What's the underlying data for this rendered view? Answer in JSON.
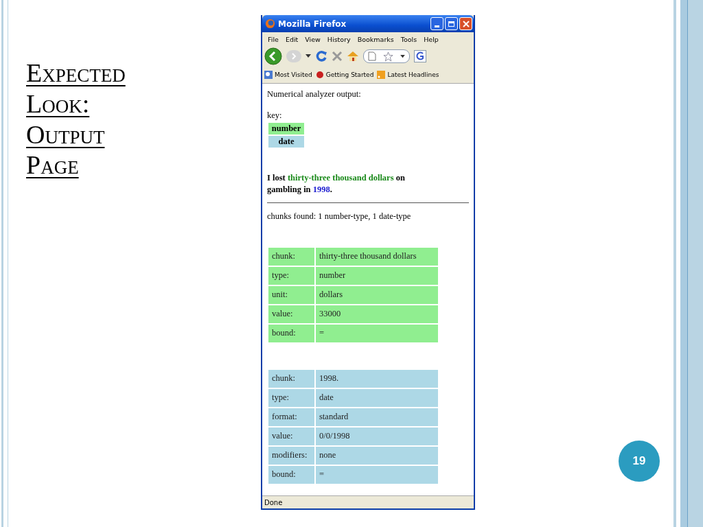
{
  "slide": {
    "title": "Expected Look: Output Page",
    "page_number": "19"
  },
  "browser": {
    "title": "Mozilla Firefox",
    "menu": [
      "File",
      "Edit",
      "View",
      "History",
      "Bookmarks",
      "Tools",
      "Help"
    ],
    "bookmarks": [
      "Most Visited",
      "Getting Started",
      "Latest Headlines"
    ],
    "status": "Done"
  },
  "page": {
    "heading": "Numerical analyzer output:",
    "key_label": "key:",
    "key": [
      {
        "label": "number",
        "color": "#90ee90"
      },
      {
        "label": "date",
        "color": "#add8e6"
      }
    ],
    "sentence": [
      {
        "text": "I lost ",
        "kind": "plain"
      },
      {
        "text": "thirty-three thousand dollars",
        "kind": "number"
      },
      {
        "text": " on gambling in ",
        "kind": "plain"
      },
      {
        "text": "1998",
        "kind": "date"
      },
      {
        "text": ".",
        "kind": "plain"
      }
    ],
    "summary": "chunks found: 1 number-type, 1 date-type",
    "chunks": [
      {
        "color": "#90ee90",
        "rows": [
          {
            "field": "chunk:",
            "value": "thirty-three thousand dollars"
          },
          {
            "field": "type:",
            "value": "number"
          },
          {
            "field": "unit:",
            "value": "dollars"
          },
          {
            "field": "value:",
            "value": "33000"
          },
          {
            "field": "bound:",
            "value": "="
          }
        ]
      },
      {
        "color": "#add8e6",
        "rows": [
          {
            "field": "chunk:",
            "value": "1998."
          },
          {
            "field": "type:",
            "value": "date"
          },
          {
            "field": "format:",
            "value": "standard"
          },
          {
            "field": "value:",
            "value": "0/0/1998"
          },
          {
            "field": "modifiers:",
            "value": "none"
          },
          {
            "field": "bound:",
            "value": "="
          }
        ]
      }
    ]
  }
}
